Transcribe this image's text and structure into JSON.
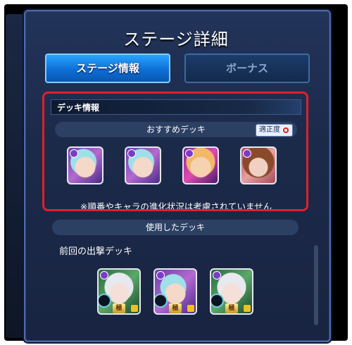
{
  "window": {
    "title": "ステージ詳細"
  },
  "tabs": [
    {
      "label": "ステージ情報",
      "active": true
    },
    {
      "label": "ボーナス",
      "active": false
    }
  ],
  "deck_info": {
    "header": "デッキ情報",
    "recommended_label": "おすすめデッキ",
    "fit_badge": "適正度",
    "characters": [
      {
        "icon": "character-portrait-icon"
      },
      {
        "icon": "character-portrait-icon"
      },
      {
        "icon": "character-portrait-icon"
      },
      {
        "icon": "character-portrait-icon"
      }
    ],
    "note": "※順番やキャラの進化状況は考慮されていません"
  },
  "used_deck": {
    "header": "使用したデッキ",
    "previous_label": "前回の出撃デッキ",
    "characters": [
      {
        "badge": "極"
      },
      {
        "badge": "極"
      },
      {
        "badge": "極"
      }
    ]
  },
  "colors": {
    "accent": "#0d6fd6",
    "highlight": "#e0202a",
    "panel": "#1c2a4a"
  }
}
